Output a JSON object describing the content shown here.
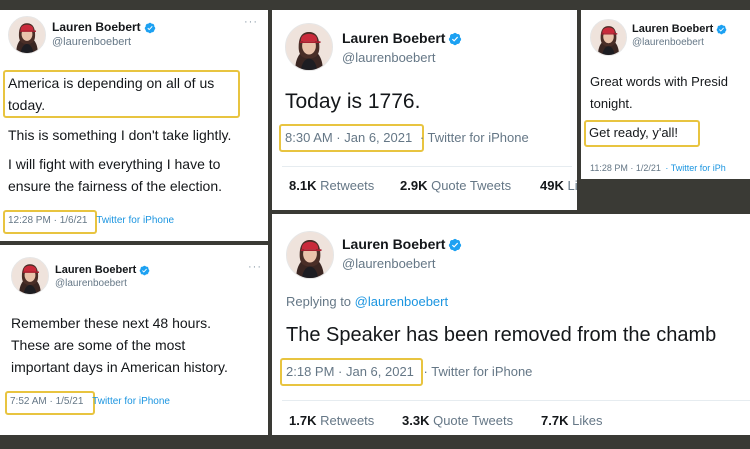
{
  "author": {
    "name": "Lauren Boebert",
    "handle": "@laurenboebert"
  },
  "colors": {
    "highlight": "#e8c440",
    "link": "#1b95e0",
    "muted": "#657786",
    "text": "#14171a",
    "background": "#3a3a35"
  },
  "tweets": {
    "t1": {
      "line1": "America is depending on all of us",
      "line2": "today.",
      "line3": "This is something I don't take lightly.",
      "line4": "I will fight with everything I have to",
      "line5": "ensure the fairness of the election.",
      "time": "12:28 PM · 1/6/21",
      "source": "Twitter for iPhone",
      "menu": "···"
    },
    "t2": {
      "text": "Today is 1776.",
      "time": "8:30 AM · Jan 6, 2021",
      "source": "· Twitter for iPhone",
      "retweets_count": "8.1K",
      "retweets_label": "Retweets",
      "quotes_count": "2.9K",
      "quotes_label": "Quote Tweets",
      "likes_count": "49K",
      "likes_label": "Likes"
    },
    "t3": {
      "line1": "Great words with Presid",
      "line2": "tonight.",
      "line3": "Get ready, y'all!",
      "time": "11:28 PM · 1/2/21",
      "source": "· Twitter for iPh"
    },
    "t4": {
      "line1": "Remember these next 48 hours.",
      "line2": "These are some of the most",
      "line3": "important days in American history.",
      "time": "7:52 AM · 1/5/21",
      "source": "Twitter for iPhone",
      "menu": "···"
    },
    "t5": {
      "reply_prefix": "Replying to",
      "reply_handle": "@laurenboebert",
      "text": "The Speaker has been removed from the chamb",
      "time": "2:18 PM · Jan 6, 2021",
      "source": "· Twitter for iPhone",
      "retweets_count": "1.7K",
      "retweets_label": "Retweets",
      "quotes_count": "3.3K",
      "quotes_label": "Quote Tweets",
      "likes_count": "7.7K",
      "likes_label": "Likes"
    }
  }
}
